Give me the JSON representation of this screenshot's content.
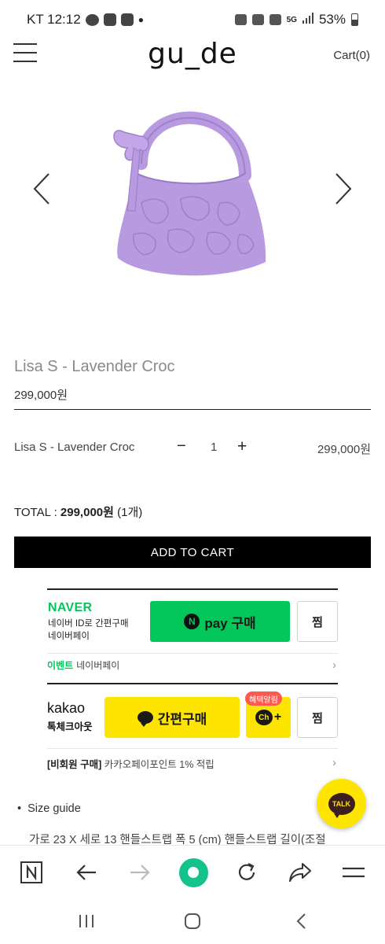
{
  "status_bar": {
    "carrier_time": "KT 12:12",
    "battery": "53%",
    "network": "5G"
  },
  "header": {
    "logo": "gu_de",
    "cart": "Cart(0)"
  },
  "product": {
    "title": "Lisa S - Lavender Croc",
    "price": "299,000원",
    "bag_color": "#b89ae0"
  },
  "option": {
    "name": "Lisa S - Lavender Croc",
    "minus": "−",
    "quantity": "1",
    "plus": "+",
    "price": "299,000원"
  },
  "total": {
    "label": "TOTAL : ",
    "amount": "299,000원",
    "count": "(1개)"
  },
  "add_to_cart": "ADD TO CART",
  "naver_pay": {
    "logo": "NAVER",
    "sub_line1": "네이버 ID로 간편구매",
    "sub_line2": "네이버페이",
    "button_n": "N",
    "button_label": "pay 구매",
    "wish": "찜",
    "event_tag": "이벤트",
    "event_text": "네이버페이",
    "accent": "#03c75a"
  },
  "kakao_pay": {
    "logo": "kakao",
    "sub": "톡체크아웃",
    "button_label": "간편구매",
    "badge": "혜택알림",
    "ch_label": "Ch",
    "ch_plus": "+",
    "wish": "찜",
    "note_bold": "[비회원 구매]",
    "note_text": "카카오페이포인트 1% 적립",
    "accent": "#fee500"
  },
  "talk_fab": "TALK",
  "size_guide": {
    "title": "Size guide",
    "description": "가로 23 X 세로 13 핸들스트랩 폭 5 (cm) 핸들스트랩 길이(조절"
  }
}
